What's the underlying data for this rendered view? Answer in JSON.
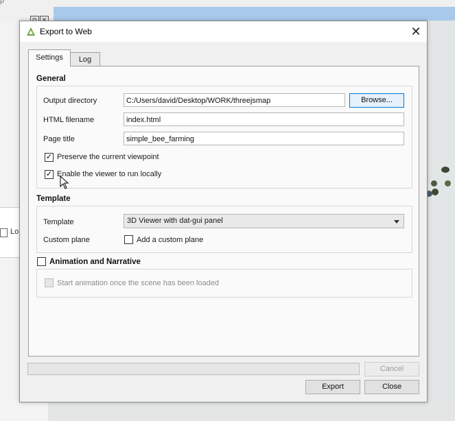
{
  "background": {
    "top_fragment": "p",
    "left_panel_label": "Lo",
    "map_color": "#a9c9ea"
  },
  "dialog": {
    "title": "Export to Web",
    "tabs": [
      {
        "label": "Settings",
        "active": true
      },
      {
        "label": "Log",
        "active": false
      }
    ],
    "general": {
      "title": "General",
      "output_directory_label": "Output directory",
      "output_directory_value": "C:/Users/david/Desktop/WORK/threejsmap",
      "browse_label": "Browse...",
      "html_filename_label": "HTML filename",
      "html_filename_value": "index.html",
      "page_title_label": "Page title",
      "page_title_value": "simple_bee_farming",
      "preserve_viewpoint_label": "Preserve the current viewpoint",
      "preserve_viewpoint_checked": true,
      "run_locally_label": "Enable the viewer to run locally",
      "run_locally_checked": true
    },
    "template": {
      "title": "Template",
      "template_label": "Template",
      "template_value": "3D Viewer with dat-gui panel",
      "custom_plane_label": "Custom plane",
      "add_custom_plane_label": "Add a custom plane",
      "add_custom_plane_checked": false
    },
    "animation": {
      "title": "Animation and Narrative",
      "checked": false,
      "start_animation_label": "Start animation once the scene has been loaded",
      "start_animation_checked": false
    },
    "progress": 0,
    "buttons": {
      "cancel": "Cancel",
      "export": "Export",
      "close": "Close"
    },
    "close_glyph": "✕",
    "check_glyph": "✓"
  }
}
